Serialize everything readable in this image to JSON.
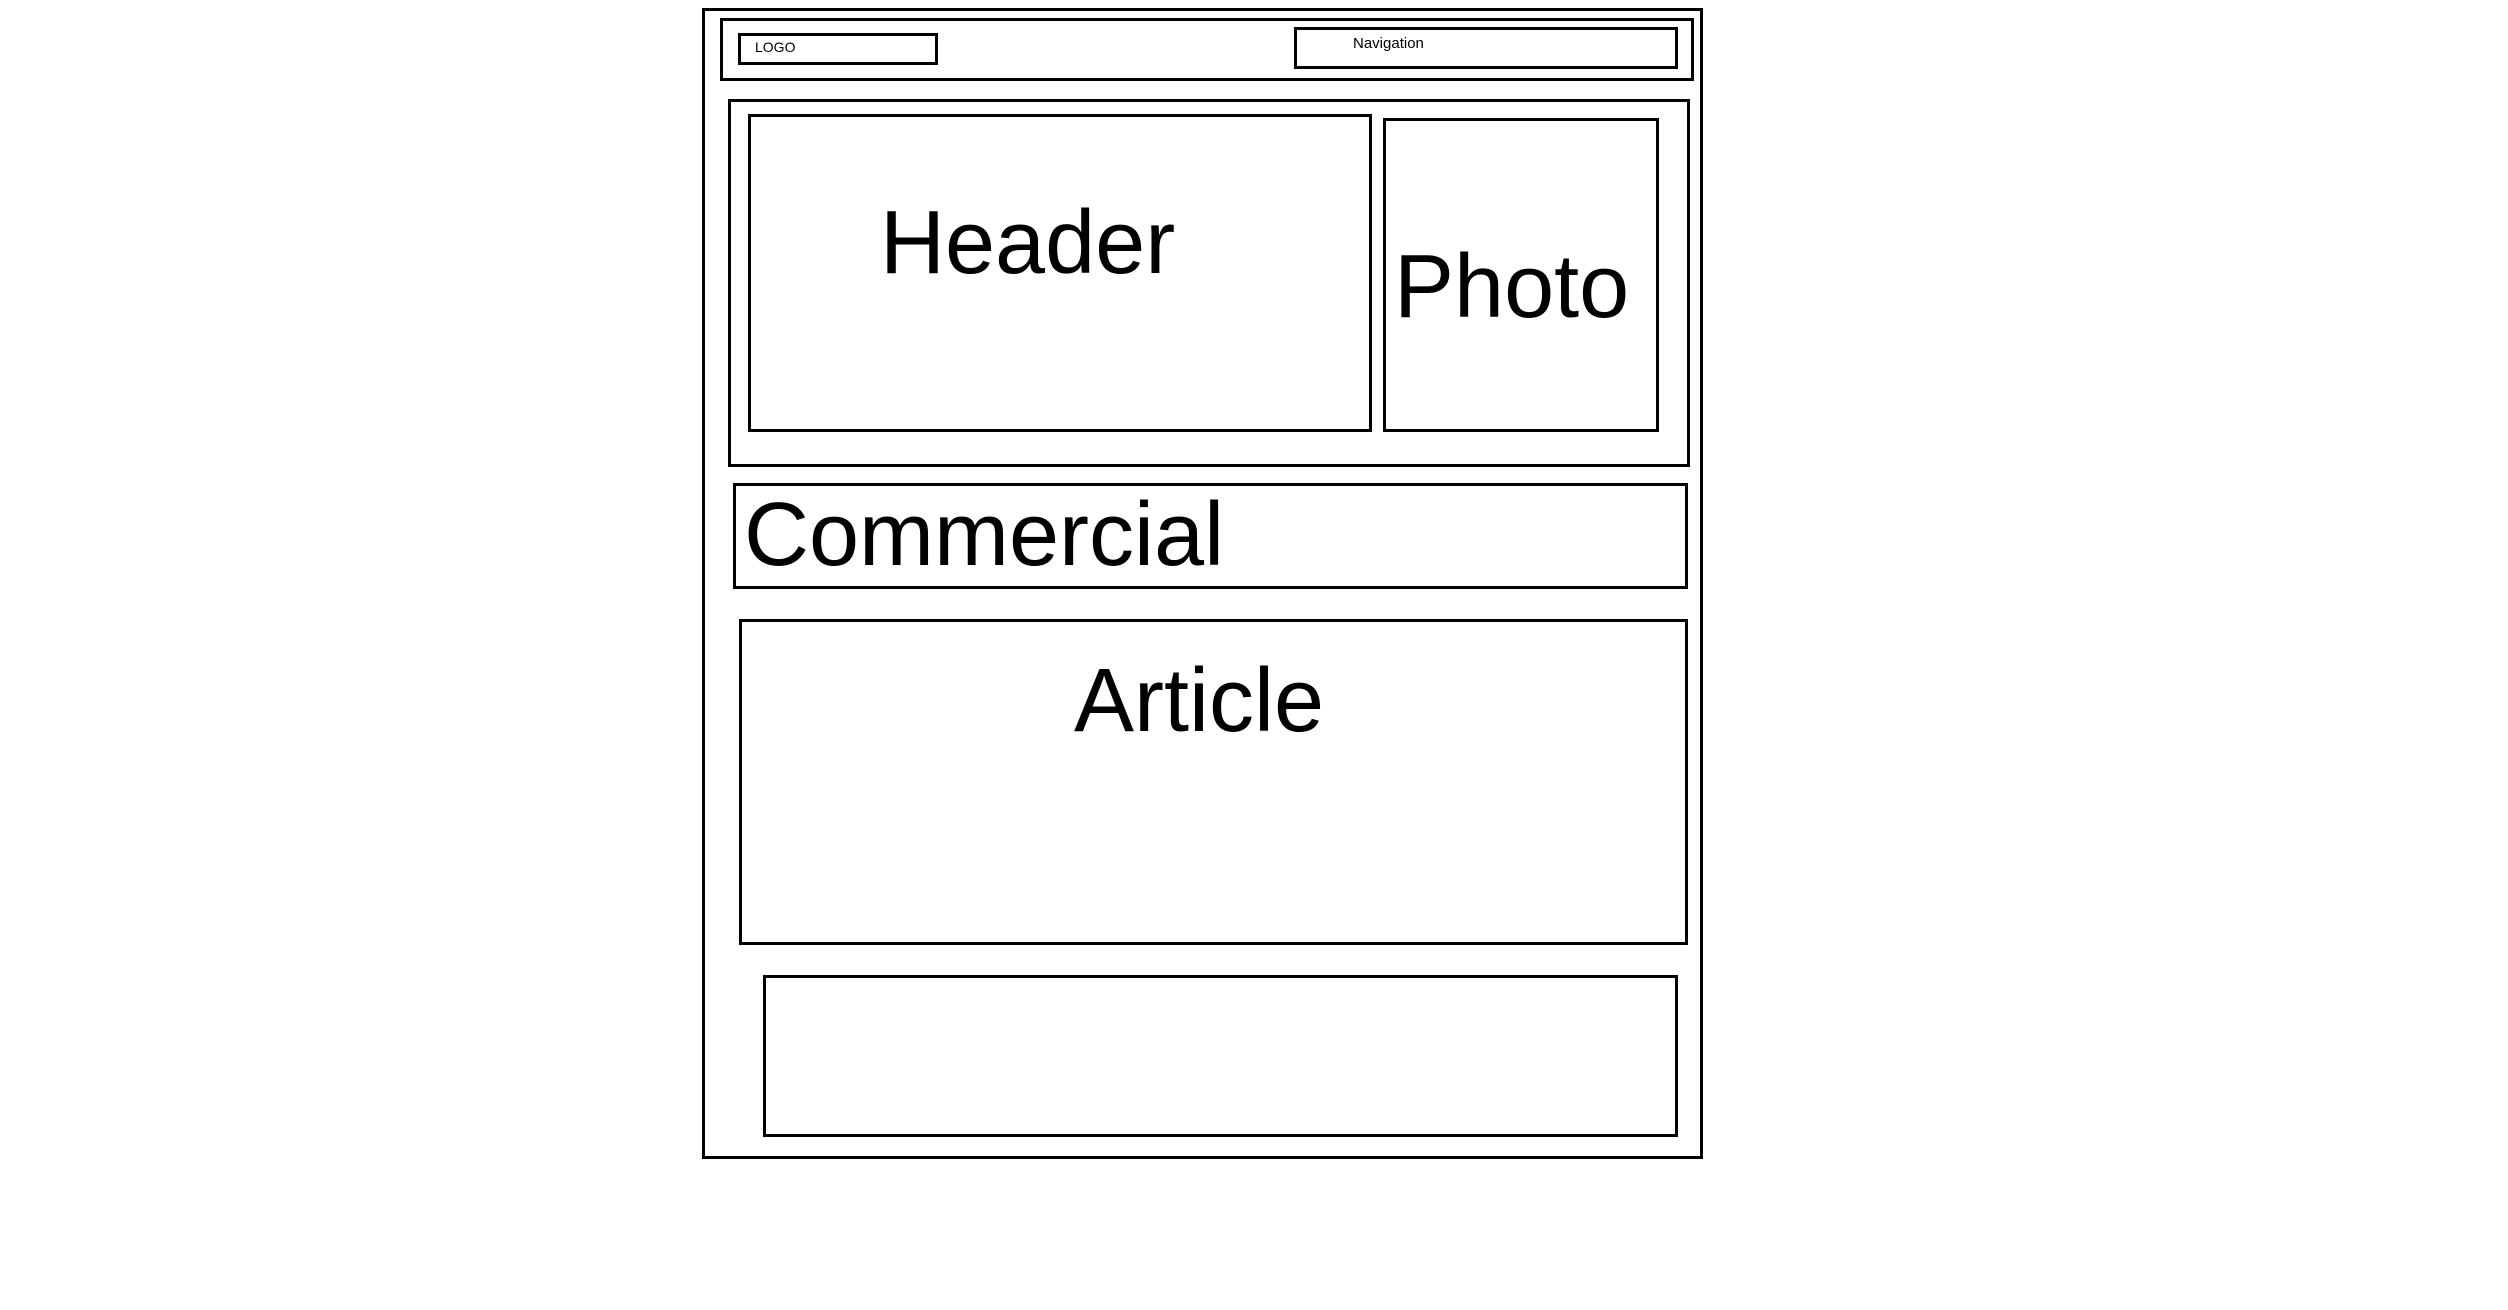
{
  "wireframe": {
    "logo_label": "LOGO",
    "navigation_label": "Navigation",
    "header_label": "Header",
    "photo_label": "Photo",
    "commercial_label": "Commercial",
    "article_label": "Article",
    "footer_label": ""
  },
  "colors": {
    "stroke": "#000000",
    "background": "#ffffff"
  }
}
